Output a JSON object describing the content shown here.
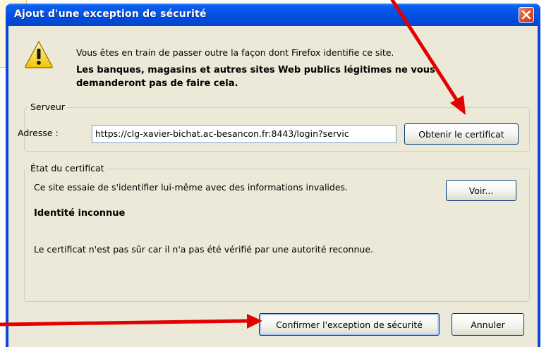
{
  "dialog": {
    "title": "Ajout d'une exception de sécurité",
    "message_line1": "Vous êtes en train de passer outre la façon dont Firefox identifie ce site.",
    "message_line2": "Les banques, magasins et autres sites Web publics légitimes ne vous demanderont pas de faire cela."
  },
  "server": {
    "legend": "Serveur",
    "address_label": "Adresse :",
    "address_value": "https://clg-xavier-bichat.ac-besancon.fr:8443/login?servic",
    "get_cert_button": "Obtenir le certificat"
  },
  "cert_status": {
    "legend": "État du certificat",
    "status_text": "Ce site essaie de s'identifier lui-même avec des informations invalides.",
    "view_button": "Voir...",
    "identity_heading": "Identité inconnue",
    "explanation": "Le certificat n'est pas sûr car il n'a pas été vérifié par une autorité reconnue."
  },
  "footer": {
    "confirm_button": "Confirmer l'exception de sécurité",
    "cancel_button": "Annuler"
  },
  "colors": {
    "titlebar": "#0553e4",
    "dialog_bg": "#ece9d8",
    "annotation_arrow": "#e40000",
    "close_button": "#e0552e"
  },
  "icons": {
    "warning": "warning-icon",
    "close": "close-icon",
    "annotation": "red-arrow-annotation"
  }
}
